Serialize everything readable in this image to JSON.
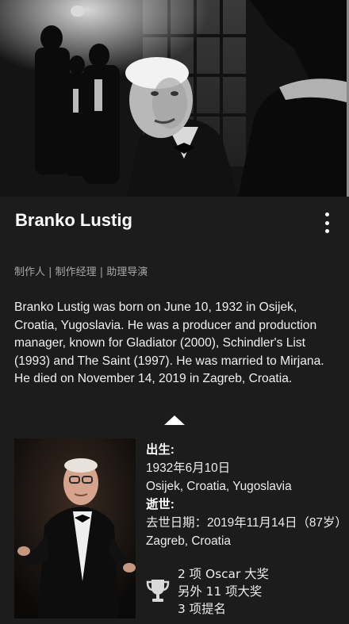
{
  "person": {
    "name": "Branko Lustig",
    "roles": "制作人 | 制作经理 | 助理导演",
    "bio": "Branko Lustig was born on June 10, 1932 in Osijek, Croatia, Yugoslavia. He was a producer and production manager, known for Gladiator (2000), Schindler's List (1993) and The Saint (1997). He was married to Mirjana. He died on November 14, 2019 in Zagreb, Croatia."
  },
  "details": {
    "born_label": "出生:",
    "born_date": "1932年6月10日",
    "born_place": "Osijek, Croatia, Yugoslavia",
    "died_label": "逝世:",
    "died_date": "去世日期：2019年11月14日（87岁）",
    "died_place": "Zagreb, Croatia"
  },
  "awards": {
    "oscars": "2 项 Oscar 大奖",
    "other_wins": "另外 11 项大奖",
    "nominations": "3 项提名"
  },
  "icons": {
    "more": "more-vertical-icon",
    "collapse": "chevron-up-icon",
    "awards": "trophy-icon"
  },
  "colors": {
    "background": "#1c1c1c",
    "text": "#ffffff",
    "muted": "#a8a8a8"
  }
}
